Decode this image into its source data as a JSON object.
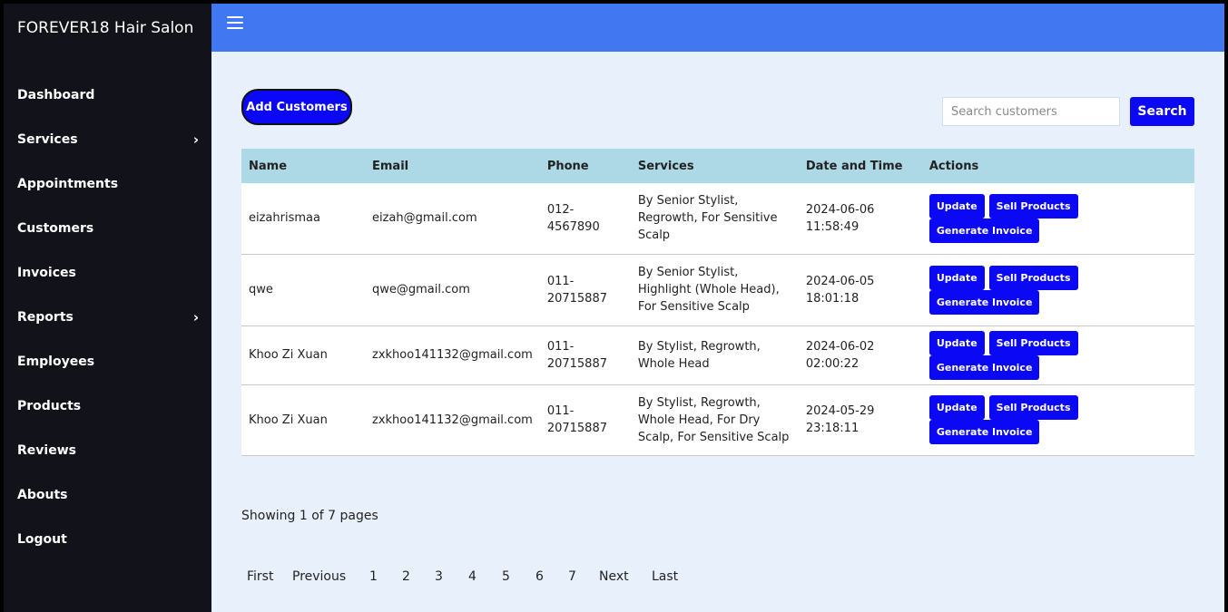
{
  "app": {
    "title": "FOREVER18 Hair Salon"
  },
  "sidebar": {
    "items": [
      {
        "label": "Dashboard",
        "has_submenu": false
      },
      {
        "label": "Services",
        "has_submenu": true
      },
      {
        "label": "Appointments",
        "has_submenu": false
      },
      {
        "label": "Customers",
        "has_submenu": false
      },
      {
        "label": "Invoices",
        "has_submenu": false
      },
      {
        "label": "Reports",
        "has_submenu": true
      },
      {
        "label": "Employees",
        "has_submenu": false
      },
      {
        "label": "Products",
        "has_submenu": false
      },
      {
        "label": "Reviews",
        "has_submenu": false
      },
      {
        "label": "Abouts",
        "has_submenu": false
      },
      {
        "label": "Logout",
        "has_submenu": false
      }
    ]
  },
  "toolbar": {
    "add_label": "Add Customers",
    "search_placeholder": "Search customers",
    "search_value": "",
    "search_label": "Search"
  },
  "table": {
    "headers": [
      "Name",
      "Email",
      "Phone",
      "Services",
      "Date and Time",
      "Actions"
    ],
    "rows": [
      {
        "name": "eizahrismaa",
        "email": "eizah@gmail.com",
        "phone": "012-4567890",
        "services": "By Senior Stylist, Regrowth, For Sensitive Scalp",
        "datetime": "2024-06-06 11:58:49"
      },
      {
        "name": "qwe",
        "email": "qwe@gmail.com",
        "phone": "011-20715887",
        "services": "By Senior Stylist, Highlight (Whole Head), For Sensitive Scalp",
        "datetime": "2024-06-05 18:01:18"
      },
      {
        "name": "Khoo Zi Xuan",
        "email": "zxkhoo141132@gmail.com",
        "phone": "011-20715887",
        "services": "By Stylist, Regrowth, Whole Head",
        "datetime": "2024-06-02 02:00:22"
      },
      {
        "name": "Khoo Zi Xuan",
        "email": "zxkhoo141132@gmail.com",
        "phone": "011-20715887",
        "services": "By Stylist, Regrowth, Whole Head, For Dry Scalp, For Sensitive Scalp",
        "datetime": "2024-05-29 23:18:11"
      }
    ],
    "actions": {
      "update": "Update",
      "sell": "Sell Products",
      "invoice": "Generate Invoice"
    }
  },
  "pagination": {
    "showing": "Showing 1 of 7 pages",
    "first": "First",
    "previous": "Previous",
    "pages": [
      "1",
      "2",
      "3",
      "4",
      "5",
      "6",
      "7"
    ],
    "next": "Next",
    "last": "Last"
  },
  "colors": {
    "sidebar_bg": "#12121a",
    "topbar_bg": "#4177f1",
    "content_bg": "#e8f1fb",
    "table_header_bg": "#add8e6",
    "button_bg": "#0a08f5"
  }
}
